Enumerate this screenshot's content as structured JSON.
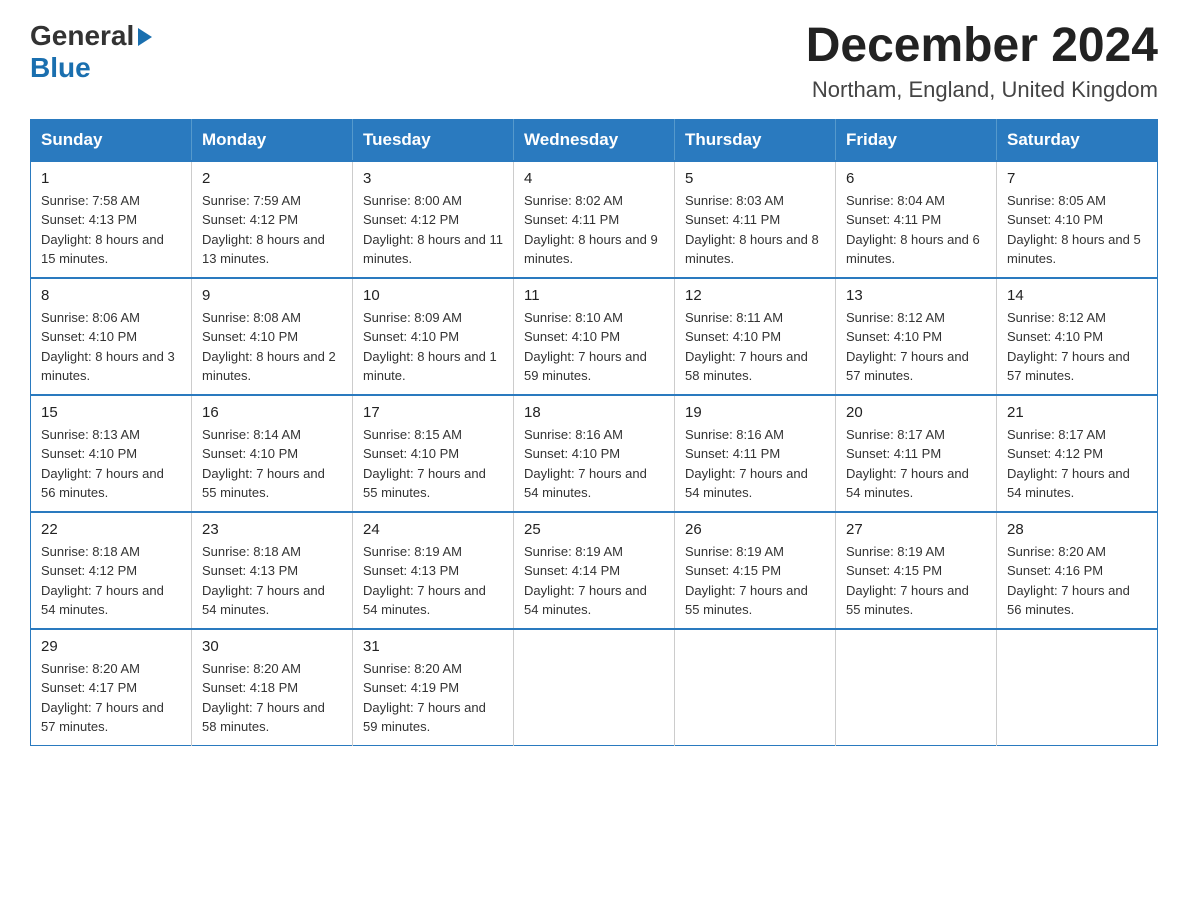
{
  "header": {
    "title": "December 2024",
    "subtitle": "Northam, England, United Kingdom",
    "logo_general": "General",
    "logo_blue": "Blue"
  },
  "days_of_week": [
    "Sunday",
    "Monday",
    "Tuesday",
    "Wednesday",
    "Thursday",
    "Friday",
    "Saturday"
  ],
  "weeks": [
    [
      {
        "day": "1",
        "sunrise": "7:58 AM",
        "sunset": "4:13 PM",
        "daylight": "8 hours and 15 minutes."
      },
      {
        "day": "2",
        "sunrise": "7:59 AM",
        "sunset": "4:12 PM",
        "daylight": "8 hours and 13 minutes."
      },
      {
        "day": "3",
        "sunrise": "8:00 AM",
        "sunset": "4:12 PM",
        "daylight": "8 hours and 11 minutes."
      },
      {
        "day": "4",
        "sunrise": "8:02 AM",
        "sunset": "4:11 PM",
        "daylight": "8 hours and 9 minutes."
      },
      {
        "day": "5",
        "sunrise": "8:03 AM",
        "sunset": "4:11 PM",
        "daylight": "8 hours and 8 minutes."
      },
      {
        "day": "6",
        "sunrise": "8:04 AM",
        "sunset": "4:11 PM",
        "daylight": "8 hours and 6 minutes."
      },
      {
        "day": "7",
        "sunrise": "8:05 AM",
        "sunset": "4:10 PM",
        "daylight": "8 hours and 5 minutes."
      }
    ],
    [
      {
        "day": "8",
        "sunrise": "8:06 AM",
        "sunset": "4:10 PM",
        "daylight": "8 hours and 3 minutes."
      },
      {
        "day": "9",
        "sunrise": "8:08 AM",
        "sunset": "4:10 PM",
        "daylight": "8 hours and 2 minutes."
      },
      {
        "day": "10",
        "sunrise": "8:09 AM",
        "sunset": "4:10 PM",
        "daylight": "8 hours and 1 minute."
      },
      {
        "day": "11",
        "sunrise": "8:10 AM",
        "sunset": "4:10 PM",
        "daylight": "7 hours and 59 minutes."
      },
      {
        "day": "12",
        "sunrise": "8:11 AM",
        "sunset": "4:10 PM",
        "daylight": "7 hours and 58 minutes."
      },
      {
        "day": "13",
        "sunrise": "8:12 AM",
        "sunset": "4:10 PM",
        "daylight": "7 hours and 57 minutes."
      },
      {
        "day": "14",
        "sunrise": "8:12 AM",
        "sunset": "4:10 PM",
        "daylight": "7 hours and 57 minutes."
      }
    ],
    [
      {
        "day": "15",
        "sunrise": "8:13 AM",
        "sunset": "4:10 PM",
        "daylight": "7 hours and 56 minutes."
      },
      {
        "day": "16",
        "sunrise": "8:14 AM",
        "sunset": "4:10 PM",
        "daylight": "7 hours and 55 minutes."
      },
      {
        "day": "17",
        "sunrise": "8:15 AM",
        "sunset": "4:10 PM",
        "daylight": "7 hours and 55 minutes."
      },
      {
        "day": "18",
        "sunrise": "8:16 AM",
        "sunset": "4:10 PM",
        "daylight": "7 hours and 54 minutes."
      },
      {
        "day": "19",
        "sunrise": "8:16 AM",
        "sunset": "4:11 PM",
        "daylight": "7 hours and 54 minutes."
      },
      {
        "day": "20",
        "sunrise": "8:17 AM",
        "sunset": "4:11 PM",
        "daylight": "7 hours and 54 minutes."
      },
      {
        "day": "21",
        "sunrise": "8:17 AM",
        "sunset": "4:12 PM",
        "daylight": "7 hours and 54 minutes."
      }
    ],
    [
      {
        "day": "22",
        "sunrise": "8:18 AM",
        "sunset": "4:12 PM",
        "daylight": "7 hours and 54 minutes."
      },
      {
        "day": "23",
        "sunrise": "8:18 AM",
        "sunset": "4:13 PM",
        "daylight": "7 hours and 54 minutes."
      },
      {
        "day": "24",
        "sunrise": "8:19 AM",
        "sunset": "4:13 PM",
        "daylight": "7 hours and 54 minutes."
      },
      {
        "day": "25",
        "sunrise": "8:19 AM",
        "sunset": "4:14 PM",
        "daylight": "7 hours and 54 minutes."
      },
      {
        "day": "26",
        "sunrise": "8:19 AM",
        "sunset": "4:15 PM",
        "daylight": "7 hours and 55 minutes."
      },
      {
        "day": "27",
        "sunrise": "8:19 AM",
        "sunset": "4:15 PM",
        "daylight": "7 hours and 55 minutes."
      },
      {
        "day": "28",
        "sunrise": "8:20 AM",
        "sunset": "4:16 PM",
        "daylight": "7 hours and 56 minutes."
      }
    ],
    [
      {
        "day": "29",
        "sunrise": "8:20 AM",
        "sunset": "4:17 PM",
        "daylight": "7 hours and 57 minutes."
      },
      {
        "day": "30",
        "sunrise": "8:20 AM",
        "sunset": "4:18 PM",
        "daylight": "7 hours and 58 minutes."
      },
      {
        "day": "31",
        "sunrise": "8:20 AM",
        "sunset": "4:19 PM",
        "daylight": "7 hours and 59 minutes."
      },
      null,
      null,
      null,
      null
    ]
  ],
  "labels": {
    "sunrise": "Sunrise:",
    "sunset": "Sunset:",
    "daylight": "Daylight:"
  }
}
